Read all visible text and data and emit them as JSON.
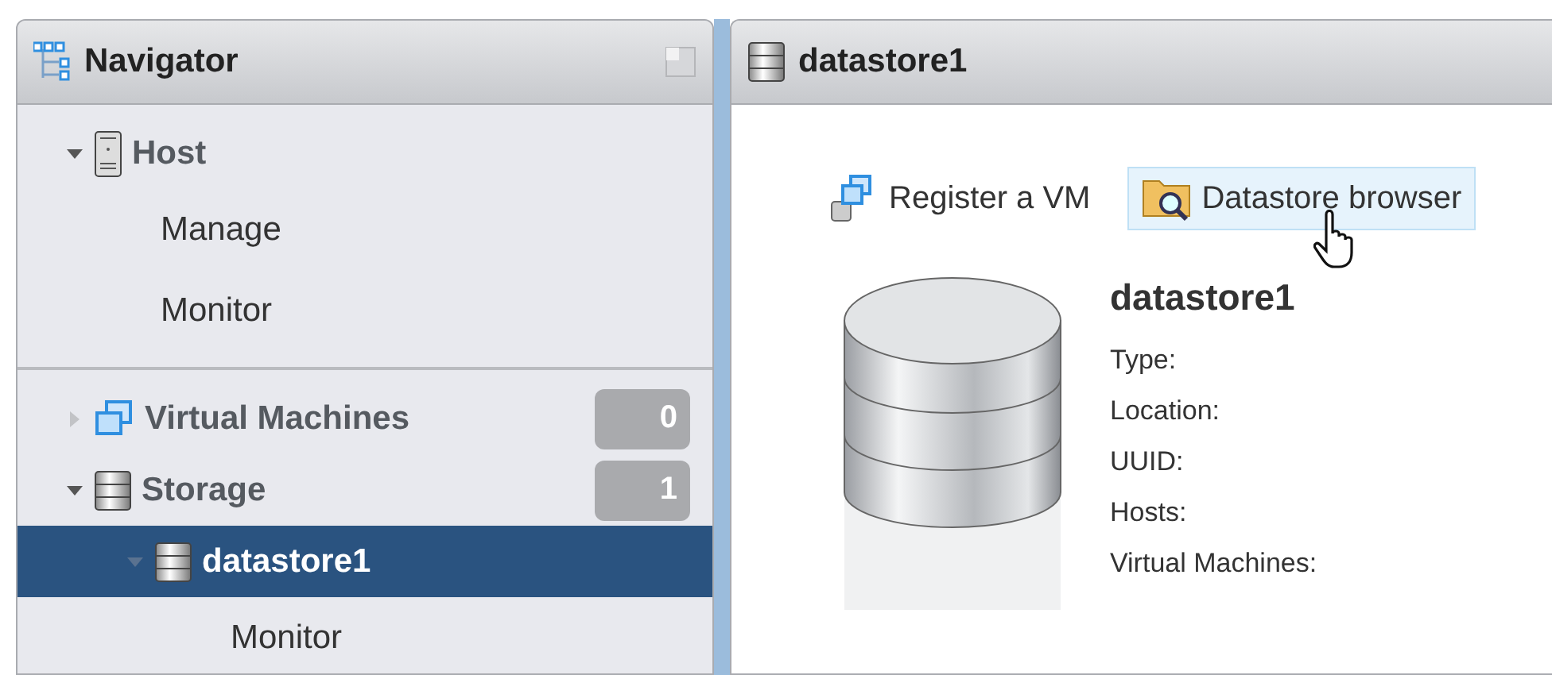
{
  "navigator": {
    "title": "Navigator",
    "sections": [
      {
        "items": [
          {
            "label": "Host",
            "kind": "host",
            "expanded": true,
            "selected": false,
            "children": [
              {
                "label": "Manage",
                "selected": false
              },
              {
                "label": "Monitor",
                "selected": false
              }
            ]
          }
        ]
      },
      {
        "items": [
          {
            "label": "Virtual Machines",
            "kind": "vms",
            "expanded": false,
            "selected": false,
            "count": "0"
          },
          {
            "label": "Storage",
            "kind": "storage",
            "expanded": true,
            "selected": false,
            "count": "1",
            "children": [
              {
                "label": "datastore1",
                "kind": "storage",
                "expanded": true,
                "selected": true,
                "children": [
                  {
                    "label": "Monitor",
                    "selected": false
                  }
                ]
              }
            ]
          }
        ]
      }
    ]
  },
  "content": {
    "title": "datastore1",
    "actions": [
      {
        "label": "Register a VM",
        "kind": "register",
        "hovered": false
      },
      {
        "label": "Datastore browser",
        "kind": "browser",
        "hovered": true
      }
    ],
    "details": {
      "name": "datastore1",
      "properties": [
        "Type:",
        "Location:",
        "UUID:",
        "Hosts:",
        "Virtual Machines:"
      ]
    }
  }
}
